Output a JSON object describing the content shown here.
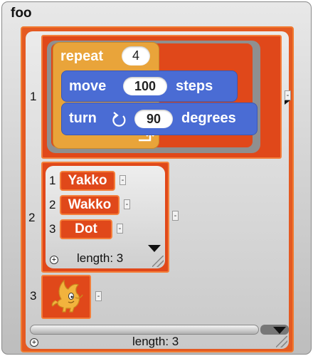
{
  "watcher": {
    "title": "foo"
  },
  "outer_list": {
    "items": [
      {
        "index": "1"
      },
      {
        "index": "2"
      },
      {
        "index": "3"
      }
    ],
    "length_label": "length: 3",
    "minus_label": "-",
    "plus_label": "+"
  },
  "script": {
    "repeat": {
      "label": "repeat",
      "count": "4"
    },
    "move": {
      "label": "move",
      "value": "100",
      "suffix": "steps"
    },
    "turn": {
      "label": "turn",
      "value": "90",
      "suffix": "degrees"
    }
  },
  "inner_list": {
    "items": [
      {
        "index": "1",
        "name": "Yakko"
      },
      {
        "index": "2",
        "name": "Wakko"
      },
      {
        "index": "3",
        "name": "Dot"
      }
    ],
    "length_label": "length: 3",
    "minus_label": "-",
    "plus_label": "+"
  },
  "colors": {
    "list_orange": "#e0481a",
    "repeat_block": "#e9a43a",
    "motion_block": "#4a6cd4"
  }
}
